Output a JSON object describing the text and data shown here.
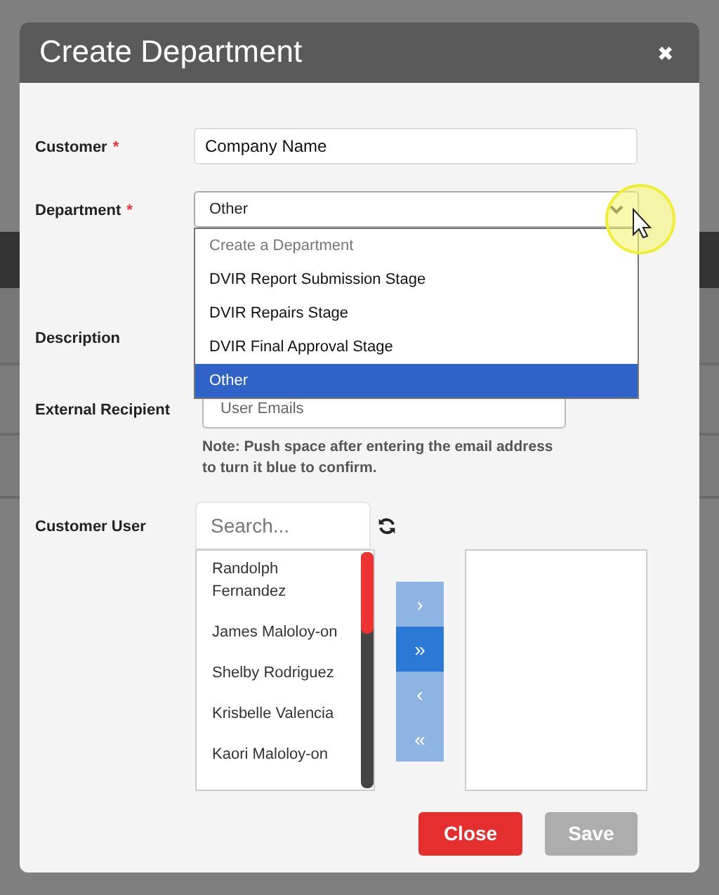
{
  "dialog": {
    "title": "Create Department",
    "close_icon": "✖"
  },
  "fields": [
    {
      "kind": "text",
      "label": "Customer",
      "required_mark": "*",
      "value": "Company Name"
    },
    {
      "kind": "select",
      "label": "Department",
      "required_mark": "*",
      "value": "Other",
      "expanded": true,
      "options": [
        {
          "label": "Create a Department",
          "kind": "placeholder",
          "selected": false
        },
        {
          "label": "DVIR Report Submission Stage",
          "kind": "option",
          "selected": false
        },
        {
          "label": "DVIR Repairs Stage",
          "kind": "option",
          "selected": false
        },
        {
          "label": "DVIR Final Approval Stage",
          "kind": "option",
          "selected": false
        },
        {
          "label": "Other",
          "kind": "option",
          "selected": true
        }
      ]
    },
    {
      "kind": "hidden",
      "label": "Description"
    },
    {
      "kind": "email",
      "label": "External Recipient",
      "placeholder": "User Emails",
      "note": "Note: Push space after entering the email address to turn it blue to confirm."
    }
  ],
  "customer_user": {
    "label": "Customer User",
    "search_placeholder": "Search...",
    "available": [
      "Randolph Fernandez",
      "James Maloloy-on",
      "Shelby Rodriguez",
      "Krisbelle Valencia",
      "Kaori Maloloy-on"
    ],
    "transfer_buttons": [
      {
        "label": "›",
        "hovered": false
      },
      {
        "label": "»",
        "hovered": true
      },
      {
        "label": "‹",
        "hovered": false
      },
      {
        "label": "«",
        "hovered": false
      }
    ]
  },
  "buttons": [
    {
      "label": "Close",
      "kind": "danger",
      "disabled": false
    },
    {
      "label": "Save",
      "kind": "primary",
      "disabled": true
    }
  ]
}
